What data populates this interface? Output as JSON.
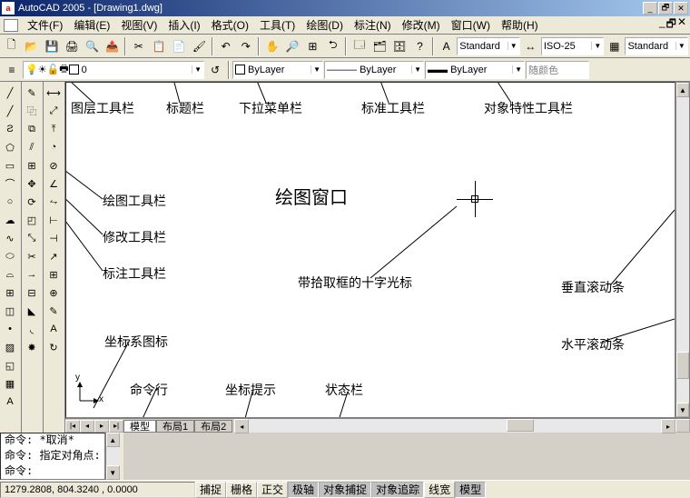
{
  "titlebar": {
    "title": "AutoCAD 2005 - [Drawing1.dwg]",
    "app_glyph": "a"
  },
  "menus": [
    "文件(F)",
    "编辑(E)",
    "视图(V)",
    "插入(I)",
    "格式(O)",
    "工具(T)",
    "绘图(D)",
    "标注(N)",
    "修改(M)",
    "窗口(W)",
    "帮助(H)"
  ],
  "toolbar1_combos": {
    "style1": "Standard",
    "dimstyle": "ISO-25",
    "style2": "Standard"
  },
  "layer_toolbar": {
    "layer_name": "0",
    "color": "ByLayer",
    "linetype": "ByLayer",
    "lineweight": "ByLayer",
    "plotcolor_label": "随颜色"
  },
  "tabs": [
    "模型",
    "布局1",
    "布局2"
  ],
  "command_lines": [
    "命令: *取消*",
    "命令: 指定对角点:",
    "命令:"
  ],
  "status": {
    "coords": "1279.2808, 804.3240 , 0.0000",
    "buttons": [
      "捕捉",
      "栅格",
      "正交",
      "极轴",
      "对象捕捉",
      "对象追踪",
      "线宽",
      "模型"
    ]
  },
  "annotations": {
    "layer_toolbar": "图层工具栏",
    "title_bar": "标题栏",
    "menu_bar": "下拉菜单栏",
    "std_toolbar": "标准工具栏",
    "prop_toolbar": "对象特性工具栏",
    "draw_toolbar": "绘图工具栏",
    "modify_toolbar": "修改工具栏",
    "dim_toolbar": "标注工具栏",
    "draw_window": "绘图窗口",
    "crosshair": "带拾取框的十字光标",
    "vscroll": "垂直滚动条",
    "hscroll": "水平滚动条",
    "ucs": "坐标系图标",
    "cmdline": "命令行",
    "coord": "坐标提示",
    "statusbar": "状态栏"
  },
  "ucs": {
    "x": "x",
    "y": "y"
  }
}
